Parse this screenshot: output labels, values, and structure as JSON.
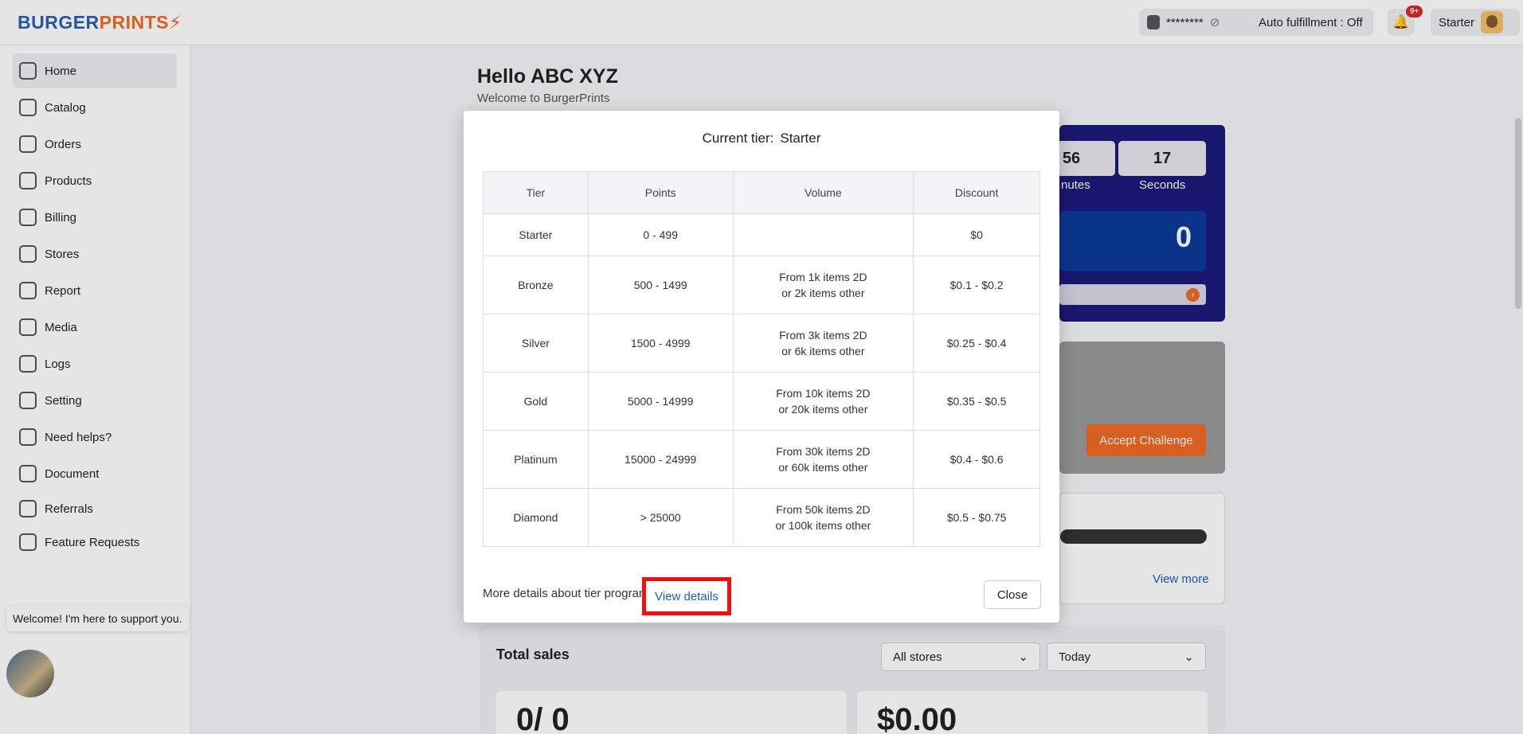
{
  "brand": {
    "part1": "BURGER",
    "part2": "PRINTS"
  },
  "topbar": {
    "masked_password": "********",
    "auto_fulfillment_label": "Auto fulfillment : ",
    "auto_fulfillment_value": "Off",
    "notification_badge": "9+",
    "user_tier": "Starter"
  },
  "sidebar": {
    "items": [
      {
        "label": "Home",
        "icon": "chart-icon"
      },
      {
        "label": "Catalog",
        "icon": "catalog-icon"
      },
      {
        "label": "Orders",
        "icon": "orders-icon"
      },
      {
        "label": "Products",
        "icon": "tag-icon"
      },
      {
        "label": "Billing",
        "icon": "wallet-icon"
      },
      {
        "label": "Stores",
        "icon": "store-icon"
      },
      {
        "label": "Report",
        "icon": "bar-chart-icon"
      },
      {
        "label": "Media",
        "icon": "image-icon"
      },
      {
        "label": "Logs",
        "icon": "history-icon"
      },
      {
        "label": "Setting",
        "icon": "gear-icon"
      },
      {
        "label": "Need helps?",
        "icon": "help-icon"
      },
      {
        "label": "Document",
        "icon": "book-icon"
      },
      {
        "label": "Referrals",
        "icon": "referral-icon"
      },
      {
        "label": "Feature Requests",
        "icon": "request-icon"
      }
    ],
    "chat_bubble": "Welcome! I'm here to support you."
  },
  "main": {
    "hello": "Hello ABC XYZ",
    "welcome": "Welcome to BurgerPrints",
    "countdown": {
      "minutes_value": "56",
      "minutes_label": "nutes",
      "seconds_value": "17",
      "seconds_label": "Seconds"
    },
    "promo_value": "0",
    "accept_button": "Accept Challenge",
    "view_more": "View more",
    "total_sales_title": "Total sales",
    "stores_select": "All stores",
    "period_select": "Today",
    "orders_stat": "0/ 0",
    "revenue_stat": "$0.00"
  },
  "modal": {
    "title_label": "Current tier:",
    "title_value": "Starter",
    "headers": [
      "Tier",
      "Points",
      "Volume",
      "Discount"
    ],
    "rows": [
      {
        "tier": "Starter",
        "points": "0 - 499",
        "volume_1": "",
        "volume_2": "",
        "discount": "$0"
      },
      {
        "tier": "Bronze",
        "points": "500 - 1499",
        "volume_1": "From 1k items 2D",
        "volume_2": "or 2k items other",
        "discount": "$0.1 - $0.2"
      },
      {
        "tier": "Silver",
        "points": "1500 - 4999",
        "volume_1": "From 3k items 2D",
        "volume_2": "or 6k items other",
        "discount": "$0.25 - $0.4"
      },
      {
        "tier": "Gold",
        "points": "5000 - 14999",
        "volume_1": "From 10k items 2D",
        "volume_2": "or 20k items other",
        "discount": "$0.35 - $0.5"
      },
      {
        "tier": "Platinum",
        "points": "15000 - 24999",
        "volume_1": "From 30k items 2D",
        "volume_2": "or 60k items other",
        "discount": "$0.4 - $0.6"
      },
      {
        "tier": "Diamond",
        "points": "> 25000",
        "volume_1": "From 50k items 2D",
        "volume_2": "or 100k items other",
        "discount": "$0.5 - $0.75"
      }
    ],
    "footer_text": "More details about tier program",
    "view_details": "View details",
    "close": "Close"
  },
  "colors": {
    "brand_blue": "#2c5fb8",
    "brand_orange": "#f06a23",
    "link_blue": "#1c5dc5",
    "highlight_red": "#ee1111"
  }
}
